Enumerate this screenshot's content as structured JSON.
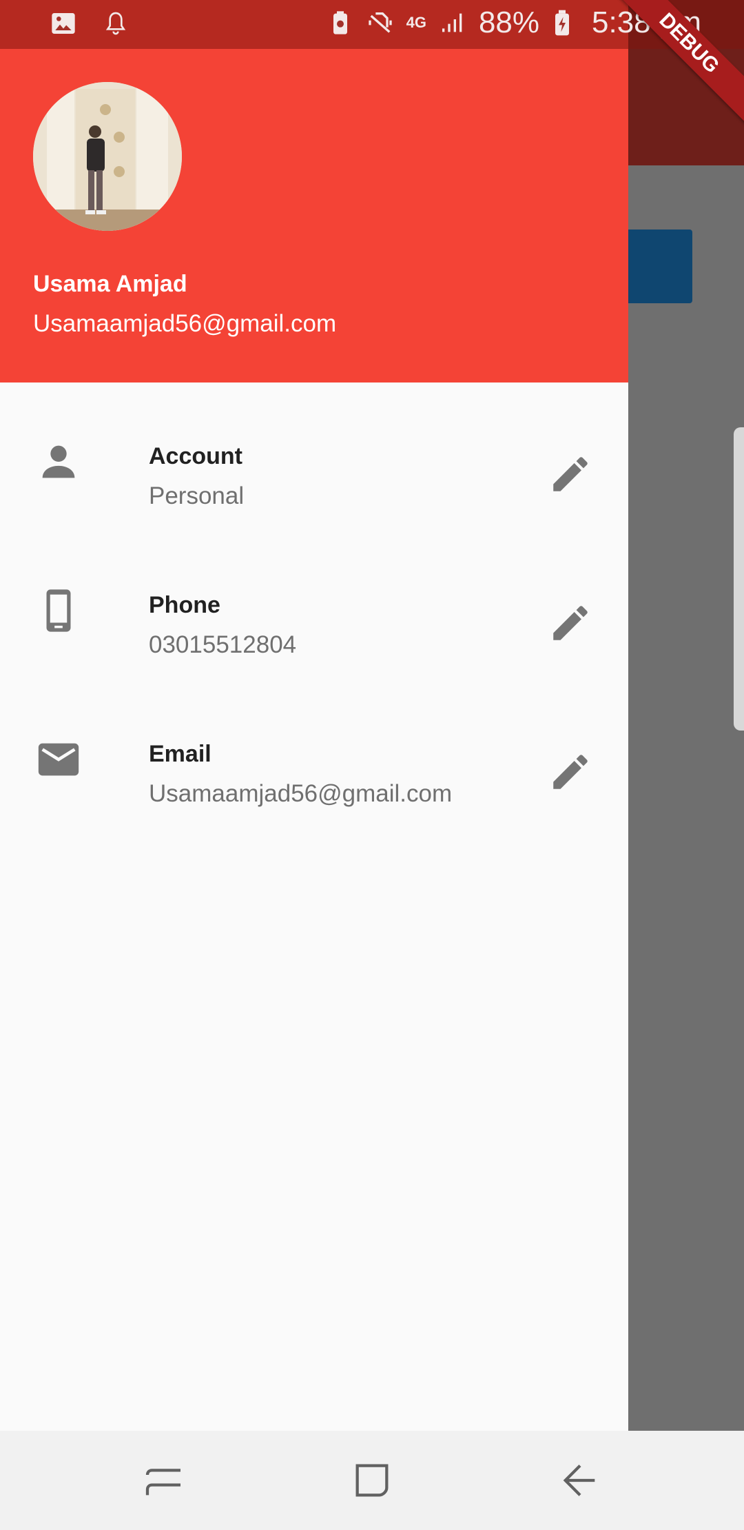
{
  "status_bar": {
    "battery_percent": "88%",
    "time": "5:38 pm",
    "network": "4G",
    "icons": [
      "image-icon",
      "notification-bell-icon",
      "battery-saver-icon",
      "vibrate-mute-icon",
      "4g-icon",
      "signal-icon",
      "battery-charging-icon"
    ]
  },
  "debug_banner": "DEBUG",
  "drawer": {
    "header": {
      "name": "Usama Amjad",
      "email": "Usamaamjad56@gmail.com",
      "background_color": "#f44336"
    },
    "items": [
      {
        "icon": "person-icon",
        "title": "Account",
        "subtitle": "Personal",
        "action_icon": "edit-icon"
      },
      {
        "icon": "phone-icon",
        "title": "Phone",
        "subtitle": "03015512804",
        "action_icon": "edit-icon"
      },
      {
        "icon": "mail-icon",
        "title": "Email",
        "subtitle": "Usamaamjad56@gmail.com",
        "action_icon": "edit-icon"
      }
    ]
  },
  "nav_bar": {
    "buttons": [
      "recents-icon",
      "home-icon",
      "back-icon"
    ]
  }
}
